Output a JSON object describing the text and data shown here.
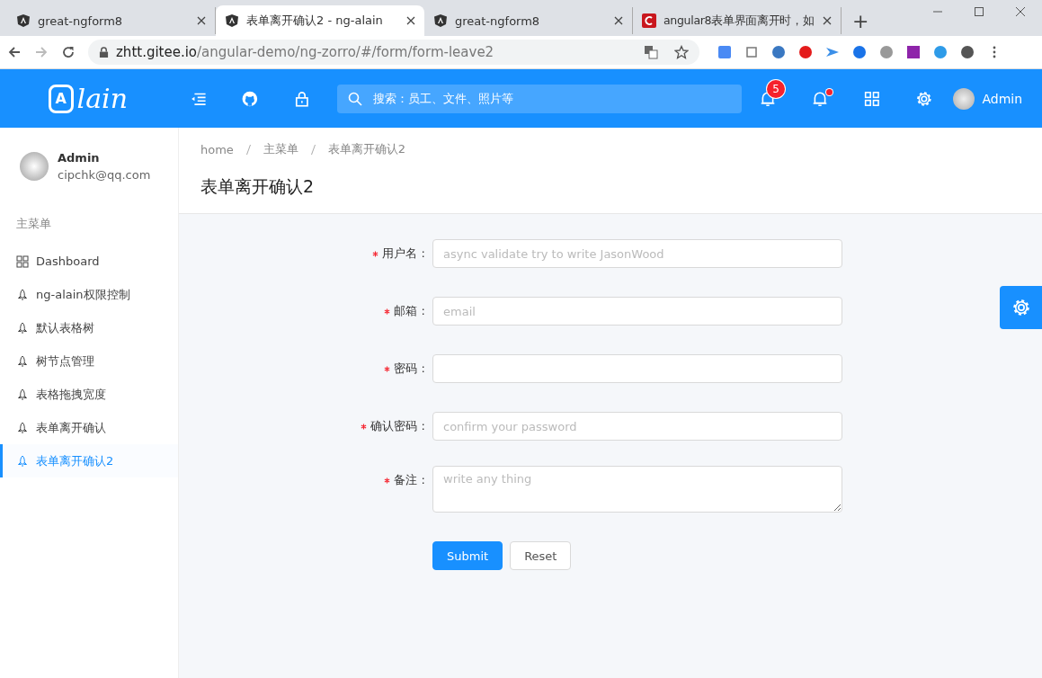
{
  "browser": {
    "tabs": [
      {
        "title": "great-ngform8",
        "kind": "angular",
        "selected": false
      },
      {
        "title": "表单离开确认2 - ng-alain",
        "kind": "angular",
        "selected": true
      },
      {
        "title": "great-ngform8",
        "kind": "angular",
        "selected": false
      },
      {
        "title": "angular8表单界面离开时，如",
        "kind": "article",
        "selected": false
      }
    ],
    "new_tab": "+",
    "address": {
      "host": "zhtt.gitee.io",
      "path": "/angular-demo/ng-zorro/#/form/form-leave2"
    }
  },
  "header": {
    "logo_mark": "A",
    "logo_text": "lain",
    "search": {
      "placeholder": "搜索：员工、文件、照片等"
    },
    "notification_count": "5",
    "unread_dot": true,
    "user": "Admin"
  },
  "sidebar": {
    "user": {
      "name": "Admin",
      "email": "cipchk@qq.com"
    },
    "group": "主菜单",
    "items": [
      {
        "label": "Dashboard",
        "kind": "dashboard",
        "selected": false
      },
      {
        "label": "ng-alain权限控制",
        "kind": "page",
        "selected": false
      },
      {
        "label": "默认表格树",
        "kind": "page",
        "selected": false
      },
      {
        "label": "树节点管理",
        "kind": "page",
        "selected": false
      },
      {
        "label": "表格拖拽宽度",
        "kind": "page",
        "selected": false
      },
      {
        "label": "表单离开确认",
        "kind": "page",
        "selected": false
      },
      {
        "label": "表单离开确认2",
        "kind": "page",
        "selected": true
      }
    ]
  },
  "breadcrumb": [
    "home",
    "主菜单",
    "表单离开确认2"
  ],
  "page_title": "表单离开确认2",
  "form": {
    "fields": [
      {
        "label": "用户名 :",
        "required": true,
        "kind": "input",
        "placeholder": "async validate try to write JasonWood"
      },
      {
        "label": "邮箱 :",
        "required": true,
        "kind": "input",
        "placeholder": "email"
      },
      {
        "label": "密码 :",
        "required": true,
        "kind": "input"
      },
      {
        "label": "确认密码 :",
        "required": true,
        "kind": "input",
        "placeholder": "confirm your password"
      },
      {
        "label": "备注 :",
        "required": true,
        "kind": "textarea",
        "placeholder": "write any thing"
      }
    ],
    "buttons": [
      {
        "label": "Submit",
        "kind": "primary"
      },
      {
        "label": "Reset",
        "kind": "default"
      }
    ]
  }
}
